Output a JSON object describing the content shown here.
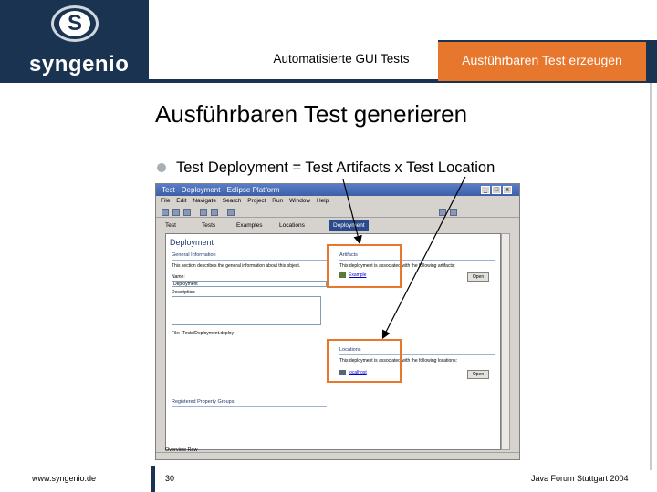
{
  "logo": {
    "letter": "S",
    "name": "syngenio"
  },
  "header": {
    "tab_title": "Automatisierte GUI Tests",
    "tab_active": "Ausführbaren Test erzeugen"
  },
  "slide": {
    "title": "Ausführbaren Test generieren",
    "bullet": "Test Deployment = Test Artifacts x Test Location"
  },
  "screenshot": {
    "window_title": "Test - Deployment - Eclipse Platform",
    "menu": [
      "File",
      "Edit",
      "Navigate",
      "Search",
      "Project",
      "Run",
      "Window",
      "Help"
    ],
    "tabs": [
      "Test",
      "Tests",
      "Examples",
      "Locations",
      "Deployment"
    ],
    "editor_heading": "Deployment",
    "general": {
      "title": "General Information",
      "desc": "This section describes the general information about this object.",
      "name_label": "Name:",
      "name_value": "Deployment",
      "description_label": "Description:",
      "file_label": "File: /Tests/Deployment.deploy"
    },
    "artifacts": {
      "title": "Artifacts",
      "desc": "This deployment is associated with the following artifacts:",
      "item": "Example",
      "button": "Open"
    },
    "locations": {
      "title": "Locations",
      "desc": "This deployment is associated with the following locations:",
      "item": "localhost",
      "button": "Open"
    },
    "registered": {
      "title": "Registered Property Groups"
    },
    "bottom_tabs": "Overview  Raw"
  },
  "footer": {
    "website": "www.syngenio.de",
    "page": "30",
    "event": "Java Forum Stuttgart 2004"
  },
  "colors": {
    "brand_navy": "#1a3350",
    "accent_orange": "#e8772e"
  }
}
